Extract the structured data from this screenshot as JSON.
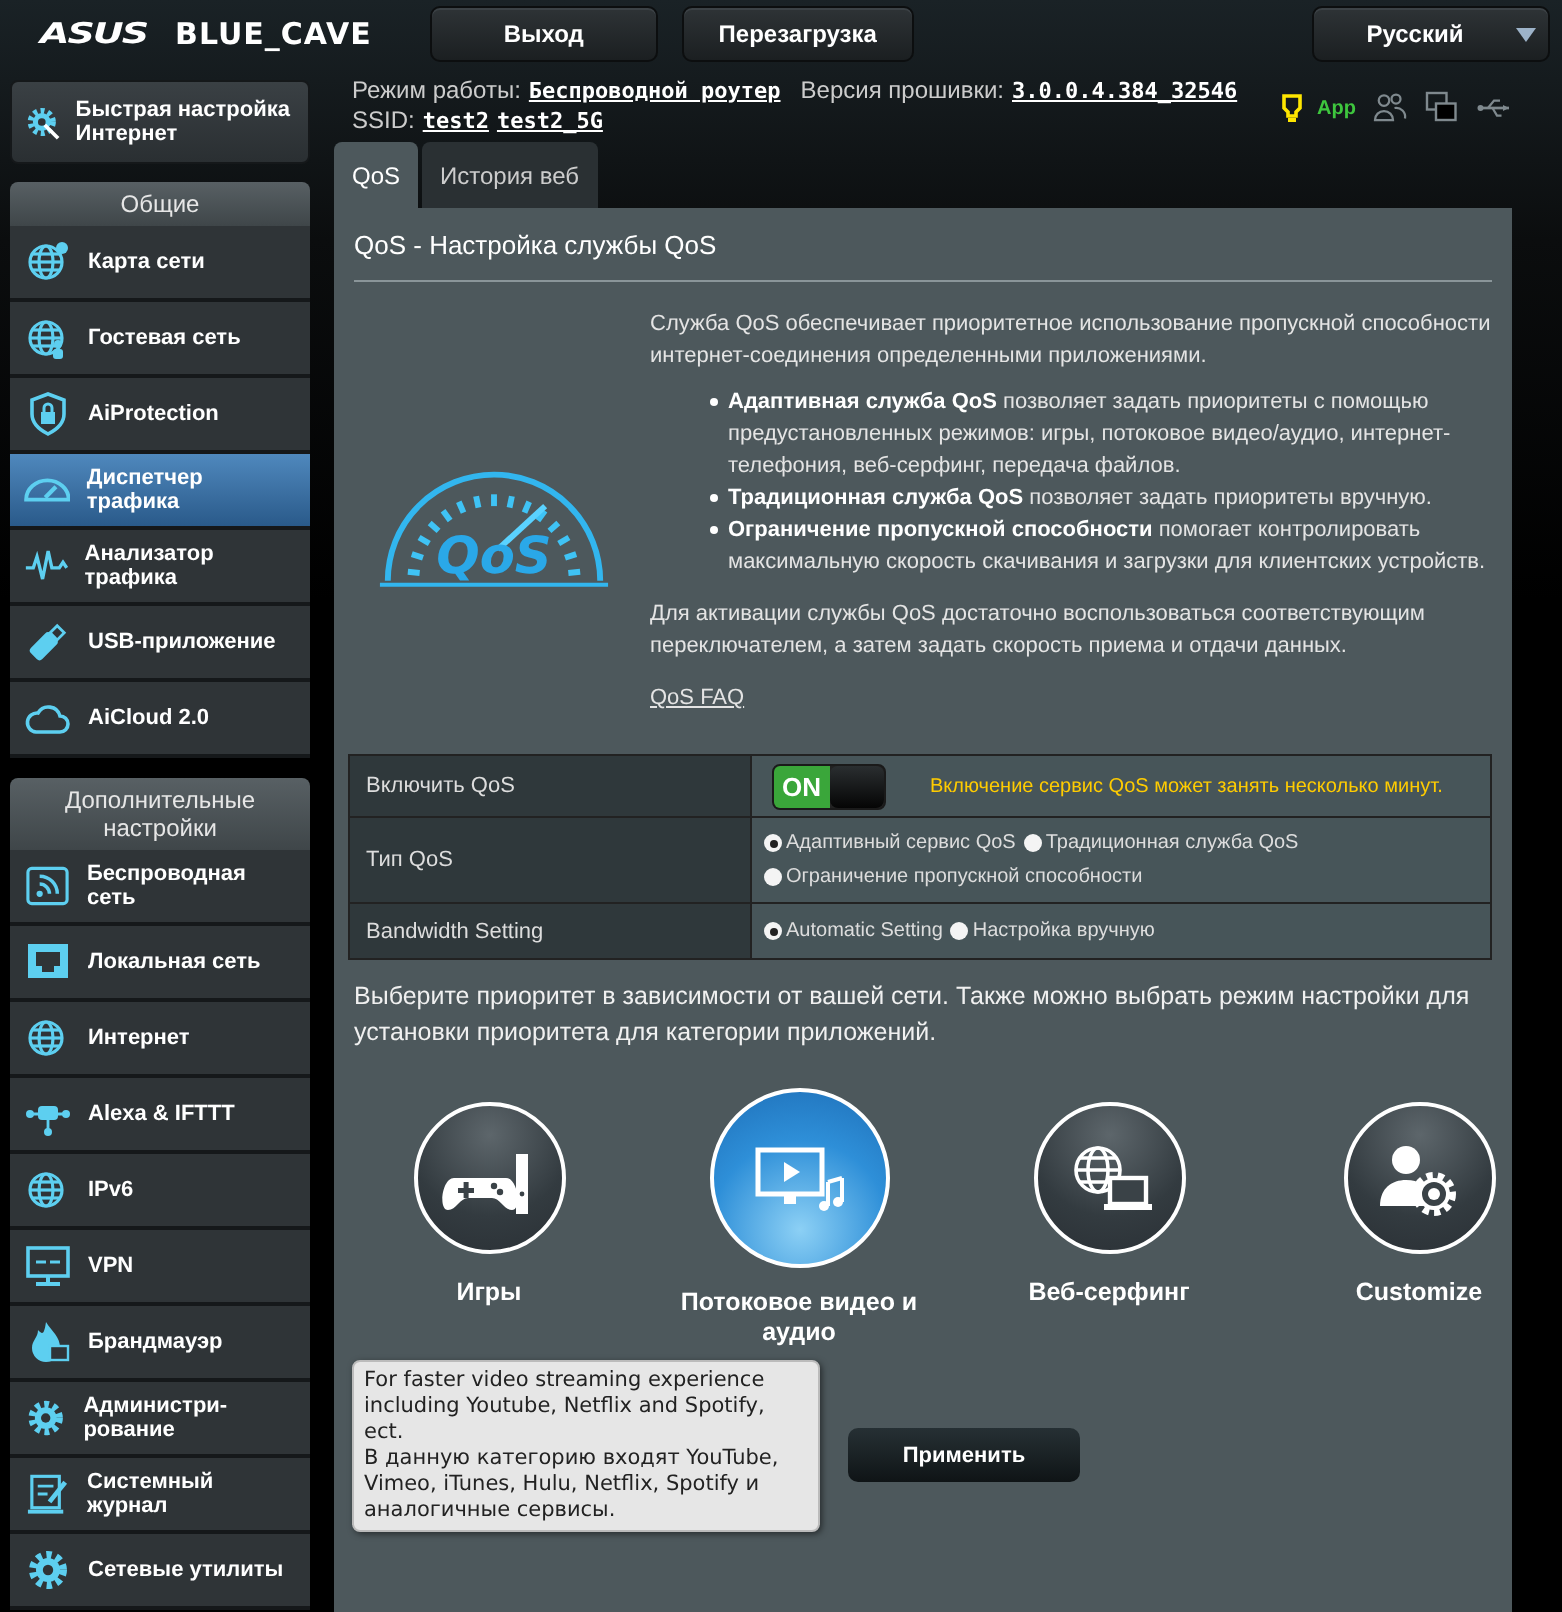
{
  "header": {
    "logo": "ASUS",
    "model": "BLUE_CAVE",
    "buttons": [
      "Выход",
      "Перезагрузка"
    ],
    "language": "Русский"
  },
  "status": {
    "mode_label": "Режим работы:",
    "mode": "Беспроводной роутер",
    "fw_label": "Версия прошивки:",
    "firmware": "3.0.0.4.384_32546",
    "ssid_label": "SSID:",
    "ssids": [
      "test2",
      "test2_5G"
    ],
    "app_label": "App"
  },
  "sidebar": {
    "quick_setup": "Быстрая настройка Интернет",
    "sections": [
      {
        "title": "Общие",
        "items": [
          {
            "label": "Карта сети",
            "selected": false
          },
          {
            "label": "Гостевая сеть",
            "selected": false
          },
          {
            "label": "AiProtection",
            "selected": false
          },
          {
            "label": "Диспетчер трафика",
            "selected": true
          },
          {
            "label": "Анализатор трафика",
            "selected": false
          },
          {
            "label": "USB-приложение",
            "selected": false
          },
          {
            "label": "AiCloud 2.0",
            "selected": false
          }
        ]
      },
      {
        "title": "Дополнительные настройки",
        "items": [
          {
            "label": "Беспроводная сеть",
            "selected": false
          },
          {
            "label": "Локальная сеть",
            "selected": false
          },
          {
            "label": "Интернет",
            "selected": false
          },
          {
            "label": "Alexa & IFTTT",
            "selected": false
          },
          {
            "label": "IPv6",
            "selected": false
          },
          {
            "label": "VPN",
            "selected": false
          },
          {
            "label": "Брандмауэр",
            "selected": false
          },
          {
            "label": "Администри-рование",
            "selected": false
          },
          {
            "label": "Системный журнал",
            "selected": false
          },
          {
            "label": "Сетевые утилиты",
            "selected": false
          }
        ]
      }
    ]
  },
  "tabs": [
    {
      "label": "QoS",
      "selected": true
    },
    {
      "label": "История веб",
      "selected": false
    }
  ],
  "panel": {
    "title": "QoS - Настройка службы QoS",
    "logo_text": "QoS",
    "intro": "Служба QoS обеспечивает приоритетное использование пропускной способности интернет-соединения определенными приложениями.",
    "bullets": [
      "**Адаптивная служба QoS** позволяет задать приоритеты с помощью предустановленных режимов: игры, потоковое видео/аудио, интернет-телефония, веб-серфинг, передача файлов.",
      "**Традиционная служба QoS** позволяет задать приоритеты вручную.",
      "**Ограничение пропускной способности** помогает контролировать максимальную скорость скачивания и загрузки для клиентских устройств."
    ],
    "activation": "Для активации службы QoS достаточно воспользоваться соответствующим переключателем, а затем задать скорость приема и отдачи данных.",
    "faq_link": "QoS FAQ",
    "settings": [
      {
        "kind": "toggle",
        "label": "Включить QoS",
        "on": true,
        "toggle_text": "ON",
        "note": "Включение сервис QoS может занять несколько минут."
      },
      {
        "kind": "radio",
        "label": "Тип QoS",
        "options": [
          {
            "label": "Адаптивный сервис QoS",
            "selected": true
          },
          {
            "label": "Традиционная служба QoS",
            "selected": false
          },
          {
            "label": "Ограничение пропускной способности",
            "selected": false
          }
        ]
      },
      {
        "kind": "radio",
        "label": "Bandwidth Setting",
        "options": [
          {
            "label": "Automatic Setting",
            "selected": true
          },
          {
            "label": "Настройка вручную",
            "selected": false
          }
        ]
      }
    ],
    "priority_hint": "Выберите приоритет в зависимости от вашей сети. Также можно выбрать режим настройки для установки приоритета для категории приложений.",
    "categories": [
      {
        "label": "Игры",
        "selected": false
      },
      {
        "label": "Потоковое видео и аудио",
        "selected": true,
        "tooltip": [
          "For faster video streaming experience including Youtube, Netflix and Spotify, ect.",
          "В данную категорию входят YouTube, Vimeo, iTunes, Hulu, Netflix, Spotify и аналогичные сервисы."
        ]
      },
      {
        "label": "Веб-серфинг",
        "selected": false
      },
      {
        "label": "Customize",
        "selected": false
      }
    ],
    "apply_button": "Применить"
  }
}
